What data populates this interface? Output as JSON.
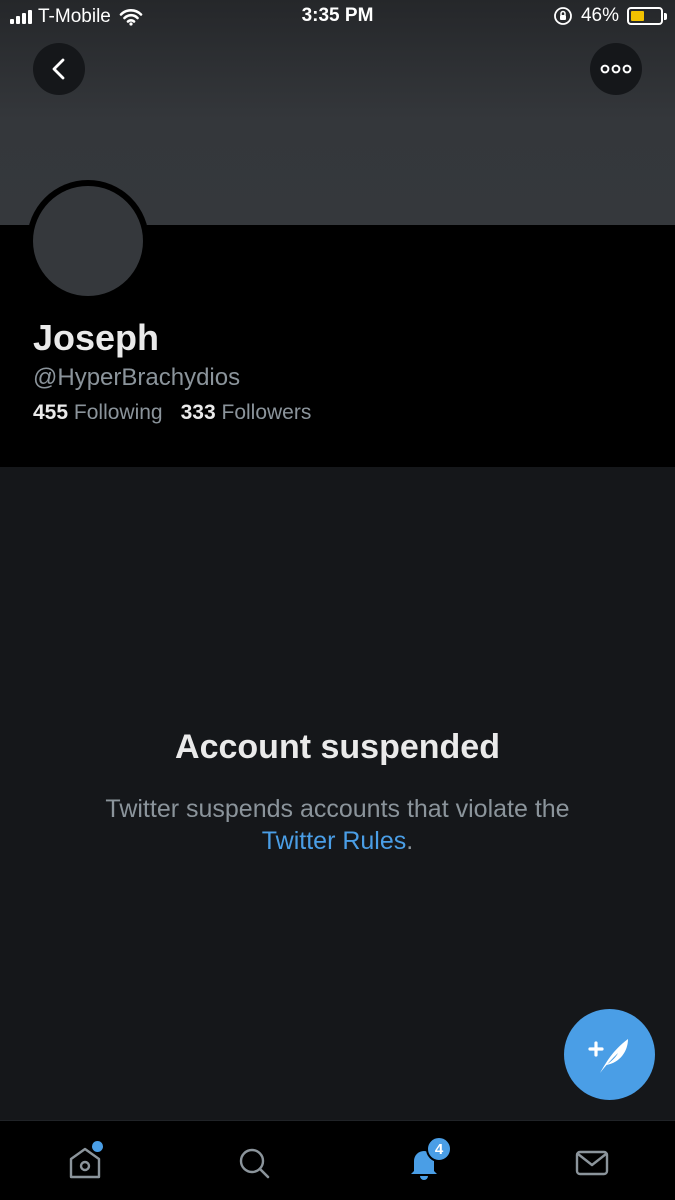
{
  "status_bar": {
    "carrier": "T-Mobile",
    "time": "3:35 PM",
    "battery_percent": "46%",
    "battery_level": 0.46,
    "battery_color": "#f2c200"
  },
  "header": {
    "back_icon": "chevron-left-icon",
    "more_icon": "more-horizontal-icon"
  },
  "profile": {
    "name": "Joseph",
    "handle": "@HyperBrachydios",
    "following_count": "455",
    "following_label": "Following",
    "followers_count": "333",
    "followers_label": "Followers"
  },
  "suspended": {
    "title": "Account suspended",
    "message": "Twitter suspends accounts that violate the",
    "link_text": "Twitter Rules",
    "suffix": "."
  },
  "fab": {
    "icon": "compose-tweet-icon"
  },
  "tabbar": {
    "tabs": [
      {
        "name": "home",
        "icon": "home-icon",
        "has_dot": true
      },
      {
        "name": "search",
        "icon": "search-icon"
      },
      {
        "name": "notifications",
        "icon": "bell-icon",
        "badge": "4",
        "active": true
      },
      {
        "name": "messages",
        "icon": "mail-icon"
      }
    ]
  },
  "colors": {
    "accent": "#4a9ee6",
    "background": "#15171a",
    "profile_background": "#000000",
    "muted_text": "#8b949b"
  }
}
